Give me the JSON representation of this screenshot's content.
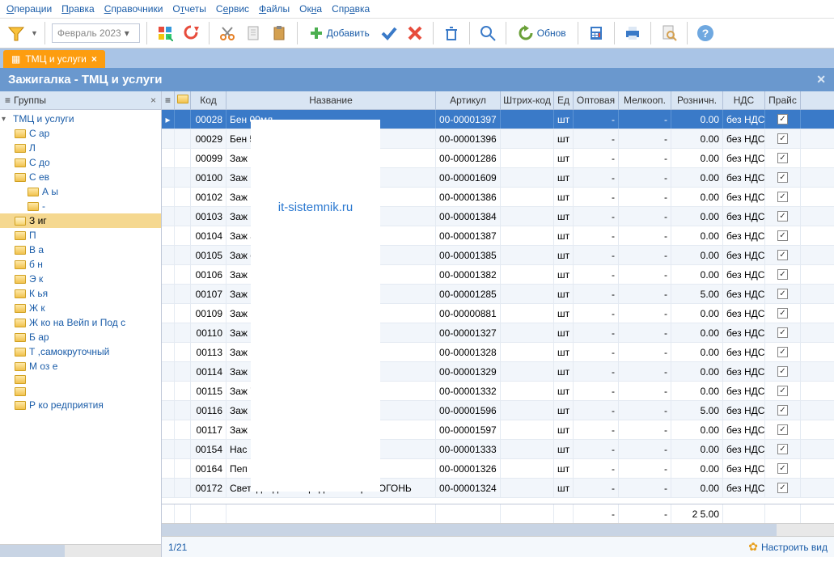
{
  "menu": [
    "Операции",
    "Правка",
    "Справочники",
    "Отчеты",
    "Сервис",
    "Файлы",
    "Окна",
    "Справка"
  ],
  "period": "Февраль 2023",
  "toolbar": {
    "add": "Добавить",
    "refresh": "Обнов"
  },
  "tab": {
    "label": "ТМЦ и услуги"
  },
  "title": "Зажигалка - ТМЦ и услуги",
  "sidebar": {
    "header": "Группы",
    "root": "ТМЦ и услуги",
    "items": [
      {
        "label": "С    ар"
      },
      {
        "label": "Л"
      },
      {
        "label": "С    до"
      },
      {
        "label": "С    ев"
      },
      {
        "label": "А          ы",
        "indent": true
      },
      {
        "label": "-",
        "indent": true
      },
      {
        "label": "З     иг",
        "sel": true
      },
      {
        "label": "П"
      },
      {
        "label": "В    а"
      },
      {
        "label": "б     н"
      },
      {
        "label": "Э          к"
      },
      {
        "label": "К    ья"
      },
      {
        "label": "Ж    к"
      },
      {
        "label": "Ж   ко      на Вейп и Под с"
      },
      {
        "label": "Б    ар"
      },
      {
        "label": "Т            ,самокруточный"
      },
      {
        "label": "М    оз      е"
      },
      {
        "label": ""
      },
      {
        "label": ""
      },
      {
        "label": "Р   ко     редприятия"
      }
    ]
  },
  "columns": [
    "",
    "",
    "Код",
    "Название",
    "Артикул",
    "Штрих-код",
    "Ед",
    "Оптовая",
    "Мелкооп.",
    "Розничн.",
    "НДС",
    "Прайс"
  ],
  "rows": [
    {
      "code": "00028",
      "name": "Бен                             00мл",
      "art": "00-00001397",
      "unit": "шт",
      "opt": "-",
      "mel": "-",
      "roz": "      0.00",
      "vat": "без НДС",
      "sel": true
    },
    {
      "code": "00029",
      "name": "Бен                             55мл",
      "art": "00-00001396",
      "unit": "шт",
      "opt": "-",
      "mel": "-",
      "roz": "0.00",
      "vat": "без НДС"
    },
    {
      "code": "00099",
      "name": "Заж",
      "art": "00-00001286",
      "unit": "шт",
      "opt": "-",
      "mel": "-",
      "roz": "0.00",
      "vat": "без НДС"
    },
    {
      "code": "00100",
      "name": "Заж                             ия",
      "art": "00-00001609",
      "unit": "шт",
      "opt": "-",
      "mel": "-",
      "roz": "0.00",
      "vat": "без НДС"
    },
    {
      "code": "00102",
      "name": "Заж",
      "art": "00-00001386",
      "unit": "шт",
      "opt": "-",
      "mel": "-",
      "roz": "0.00",
      "vat": "без НДС"
    },
    {
      "code": "00103",
      "name": "Заж                             Day Desing",
      "art": "00-00001384",
      "unit": "шт",
      "opt": "-",
      "mel": "-",
      "roz": "0.00",
      "vat": "без НДС"
    },
    {
      "code": "00104",
      "name": "Заж                             ayer Desing",
      "art": "00-00001387",
      "unit": "шт",
      "opt": "-",
      "mel": "-",
      "roz": "0.00",
      "vat": "без НДС"
    },
    {
      "code": "00105",
      "name": "Заж                             ogo Desing",
      "art": "00-00001385",
      "unit": "шт",
      "opt": "-",
      "mel": "-",
      "roz": "0.00",
      "vat": "без НДС"
    },
    {
      "code": "00106",
      "name": "Заж                             Fill Desing",
      "art": "00-00001382",
      "unit": "шт",
      "opt": "-",
      "mel": "-",
      "roz": "0.00",
      "vat": "без НДС"
    },
    {
      "code": "00107",
      "name": "Заж",
      "art": "00-00001285",
      "unit": "шт",
      "opt": "-",
      "mel": "-",
      "roz": "5.00",
      "vat": "без НДС"
    },
    {
      "code": "00109",
      "name": "Заж",
      "art": "00-00000881",
      "unit": "шт",
      "opt": "-",
      "mel": "-",
      "roz": "0.00",
      "vat": "без НДС"
    },
    {
      "code": "00110",
      "name": "Заж",
      "art": "00-00001327",
      "unit": "шт",
      "opt": "-",
      "mel": "-",
      "roz": "0.00",
      "vat": "без НДС"
    },
    {
      "code": "00113",
      "name": "Заж",
      "art": "00-00001328",
      "unit": "шт",
      "opt": "-",
      "mel": "-",
      "roz": "0.00",
      "vat": "без НДС"
    },
    {
      "code": "00114",
      "name": "Заж",
      "art": "00-00001329",
      "unit": "шт",
      "opt": "-",
      "mel": "-",
      "roz": "0.00",
      "vat": "без НДС"
    },
    {
      "code": "00115",
      "name": "Заж                             7",
      "art": "00-00001332",
      "unit": "шт",
      "opt": "-",
      "mel": "-",
      "roz": "0.00",
      "vat": "без НДС"
    },
    {
      "code": "00116",
      "name": "Заж",
      "art": "00-00001596",
      "unit": "шт",
      "opt": "-",
      "mel": "-",
      "roz": "5.00",
      "vat": "без НДС"
    },
    {
      "code": "00117",
      "name": "Заж",
      "art": "00-00001597",
      "unit": "шт",
      "opt": "-",
      "mel": "-",
      "roz": "0.00",
      "vat": "без НДС"
    },
    {
      "code": "00154",
      "name": "Нас",
      "art": "00-00001333",
      "unit": "шт",
      "opt": "-",
      "mel": "-",
      "roz": "0.00",
      "vat": "без НДС"
    },
    {
      "code": "00164",
      "name": "Пеп",
      "art": "00-00001326",
      "unit": "шт",
      "opt": "-",
      "mel": "-",
      "roz": "0.00",
      "vat": "без НДС"
    },
    {
      "code": "00172",
      "name": "Светодиодная Зарядка Фонарик ОГОНЬ",
      "art": "00-00001324",
      "unit": "шт",
      "opt": "-",
      "mel": "-",
      "roz": "0.00",
      "vat": "без НДС"
    }
  ],
  "totals": {
    "opt": "-",
    "mel": "-",
    "roz": "2      5.00"
  },
  "watermark": "it-sistemnik.ru",
  "footer": {
    "pos": "1/21",
    "cfg": "Настроить вид"
  }
}
